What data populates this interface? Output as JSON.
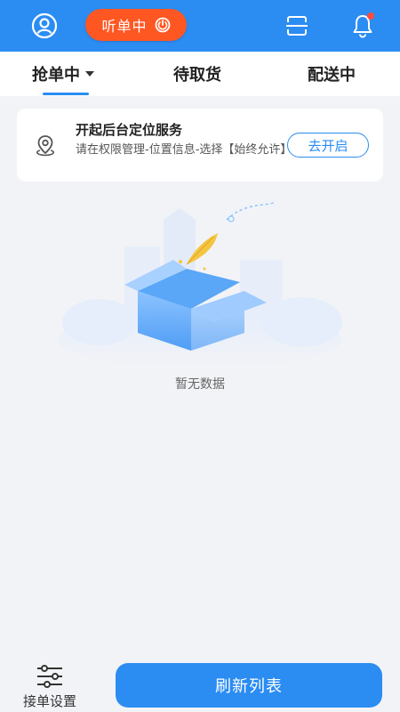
{
  "header": {
    "profile_icon": "user-circle-icon",
    "listen_status_label": "听单中",
    "power_icon": "power-icon",
    "scan_icon": "scan-icon",
    "bell_icon": "bell-icon",
    "has_notification": true,
    "colors": {
      "header_bg": "#2b8cf2",
      "listen_pill": "#ff5722",
      "notification_dot": "#ff4d3a"
    }
  },
  "tabs": [
    {
      "label": "抢单中",
      "active": true,
      "has_dropdown": true
    },
    {
      "label": "待取货",
      "active": false
    },
    {
      "label": "配送中",
      "active": false
    }
  ],
  "location_card": {
    "icon": "location-pin-icon",
    "title": "开起后台定位服务",
    "description": "请在权限管理-位置信息-选择【始终允许】",
    "button_label": "去开启"
  },
  "empty_state": {
    "illustration": "empty-box-illustration",
    "text": "暂无数据"
  },
  "bottom": {
    "settings_icon": "sliders-icon",
    "settings_label": "接单设置",
    "refresh_label": "刷新列表"
  }
}
